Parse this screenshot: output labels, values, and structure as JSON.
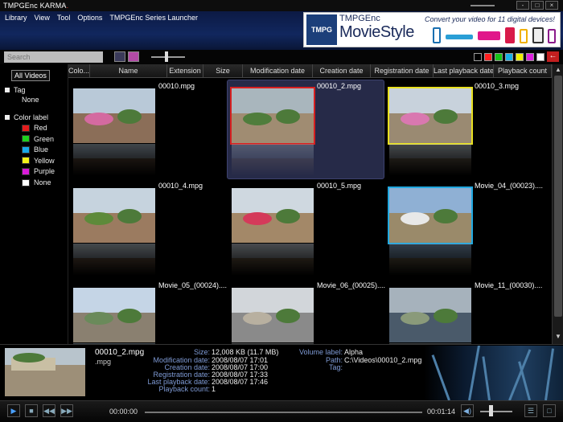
{
  "window": {
    "title_main": "TMPGEnc KARMA",
    "title_suffix": ".",
    "controls": [
      "-",
      "□",
      "×"
    ]
  },
  "menu": [
    "Library",
    "View",
    "Tool",
    "Options",
    "TMPGEnc Series Launcher"
  ],
  "banner": {
    "logo": "TMPG",
    "brand": "TMPGEnc",
    "product": "MovieStyle",
    "tagline": "Convert your video for 11 digital devices!"
  },
  "toolbar": {
    "search_placeholder": "Search",
    "zoom_level": 0.4,
    "color_filters": [
      "#000000",
      "#ff2020",
      "#18c418",
      "#18b0e8",
      "#f0f000",
      "#e020e0",
      "#ffffff"
    ],
    "back_icon": "←"
  },
  "sidebar": {
    "all_videos": "All Videos",
    "tag_label": "Tag",
    "tag_none": "None",
    "color_label": "Color label",
    "colors": [
      {
        "name": "Red",
        "hex": "#e31c1c"
      },
      {
        "name": "Green",
        "hex": "#1ecf1e"
      },
      {
        "name": "Blue",
        "hex": "#18a8e8"
      },
      {
        "name": "Yellow",
        "hex": "#f2f21a"
      },
      {
        "name": "Purple",
        "hex": "#d81ad8"
      },
      {
        "name": "None",
        "hex": "#ffffff"
      }
    ]
  },
  "columns": [
    "Colo...",
    "Name",
    "Extension",
    "Size",
    "Modification date",
    "Creation date",
    "Registration date",
    "Last playback date",
    "Playback count"
  ],
  "videos": [
    {
      "name": "00010.mpg",
      "border": ""
    },
    {
      "name": "00010_2.mpg",
      "border": "#d62020"
    },
    {
      "name": "00010_3.mpg",
      "border": "#e8e020"
    },
    {
      "name": "00010_4.mpg",
      "border": ""
    },
    {
      "name": "00010_5.mpg",
      "border": ""
    },
    {
      "name": "Movie_04_(00023)....",
      "border": "#20a8e0"
    },
    {
      "name": "Movie_05_(00024)....",
      "border": ""
    },
    {
      "name": "Movie_06_(00025)....",
      "border": ""
    },
    {
      "name": "Movie_11_(00030)....",
      "border": ""
    }
  ],
  "info": {
    "file_name": "00010_2.mpg",
    "extension": ".mpg",
    "size_label": "Size:",
    "size": "12,008 KB (11.7 MB)",
    "mod_label": "Modification date:",
    "mod_date": "2008/08/07 17:01",
    "create_label": "Creation date:",
    "create_date": "2008/08/07 17:00",
    "reg_label": "Registration date:",
    "reg_date": "2008/08/07 17:33",
    "last_label": "Last playback date:",
    "last_date": "2008/08/07 17:46",
    "count_label": "Playback count:",
    "count": "1",
    "vol_label": "Volume label:",
    "volume": "Alpha",
    "path_label": "Path:",
    "path": "C:\\Videos\\00010_2.mpg",
    "tag_label": "Tag:",
    "tag": ""
  },
  "player": {
    "current_time": "00:00:00",
    "total_time": "00:01:14",
    "progress": 0.0,
    "volume": 0.3
  }
}
